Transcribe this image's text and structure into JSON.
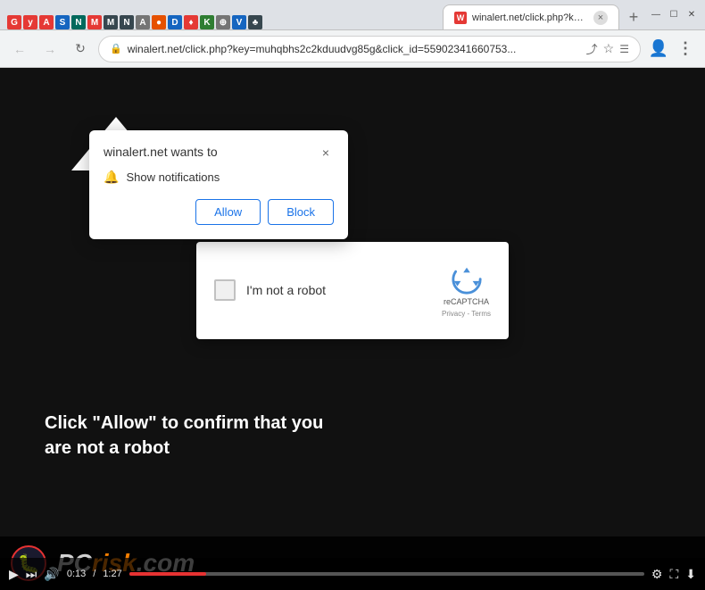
{
  "browser": {
    "tab": {
      "title": "winalert.net/click.php?key=muhqbhs2c2kduudvg85g&click_id...",
      "favicon_letter": "W"
    },
    "new_tab_label": "+",
    "window_controls": {
      "minimize": "—",
      "maximize": "☐",
      "close": "✕"
    }
  },
  "nav": {
    "back_tooltip": "Back",
    "forward_tooltip": "Forward",
    "reload_tooltip": "Reload",
    "url": "winalert.net/click.php?key=muhqbhs2c2kduudvg85g&click_id=55902341660753...",
    "bookmark_icon": "☆",
    "menu_icon": "⋮"
  },
  "notification_popup": {
    "title": "winalert.net wants to",
    "description": "Show notifications",
    "close_label": "×",
    "allow_label": "Allow",
    "block_label": "Block"
  },
  "recaptcha": {
    "checkbox_label": "I'm not a robot",
    "brand": "reCAPTCHA",
    "privacy_label": "Privacy",
    "terms_label": "Terms",
    "separator": " - "
  },
  "page": {
    "text": "Click \"Allow\" to confirm that you\nare not a robot",
    "background_color": "#111111"
  },
  "pcrisk": {
    "pc_text": "PC",
    "risk_text": "risk",
    "com_text": ".com"
  },
  "video_controls": {
    "play_icon": "▶",
    "skip_icon": "⏭",
    "volume_icon": "🔊",
    "time_current": "0:13",
    "time_total": "1:27",
    "settings_icon": "⚙",
    "fullscreen_icon": "⛶",
    "download_icon": "⬇"
  },
  "favicons": [
    {
      "letter": "G",
      "color": "fv-red"
    },
    {
      "letter": "y",
      "color": "fv-red"
    },
    {
      "letter": "A",
      "color": "fv-red"
    },
    {
      "letter": "S",
      "color": "fv-blue"
    },
    {
      "letter": "N",
      "color": "fv-teal"
    },
    {
      "letter": "M",
      "color": "fv-red"
    },
    {
      "letter": "M",
      "color": "fv-dark"
    },
    {
      "letter": "N",
      "color": "fv-dark"
    },
    {
      "letter": "A",
      "color": "fv-gray"
    },
    {
      "letter": "●",
      "color": "fv-orange"
    },
    {
      "letter": "D",
      "color": "fv-blue"
    },
    {
      "letter": "♦",
      "color": "fv-red"
    },
    {
      "letter": "K",
      "color": "fv-green"
    },
    {
      "letter": "⊕",
      "color": "fv-gray"
    },
    {
      "letter": "V",
      "color": "fv-blue"
    },
    {
      "letter": "♣",
      "color": "fv-dark"
    }
  ]
}
